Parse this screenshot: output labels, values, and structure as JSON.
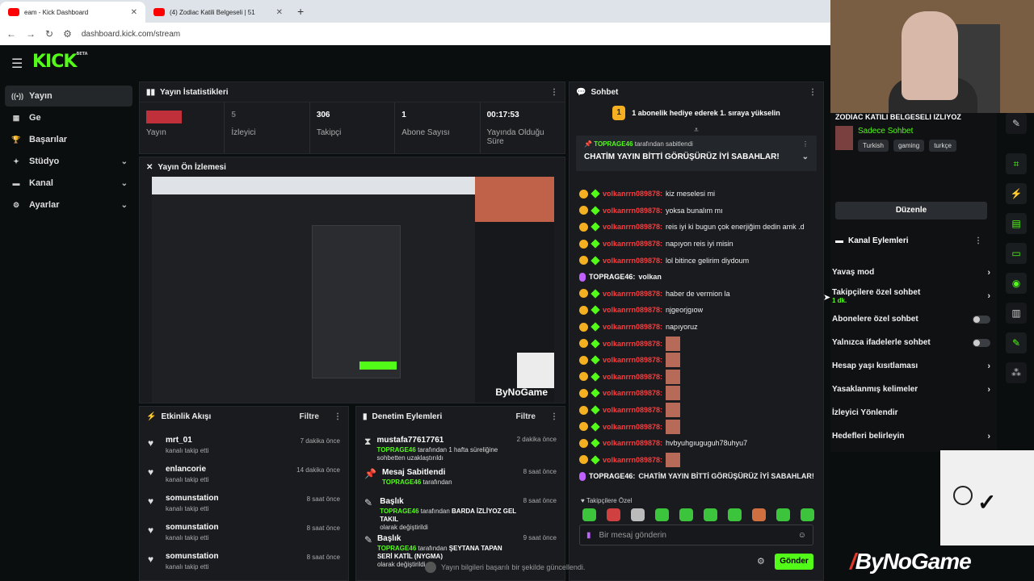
{
  "browser": {
    "tabs": [
      {
        "label": "eam - Kick Dashboard",
        "active": true
      },
      {
        "label": "(4) Zodiac Katili Belgeseli | 51",
        "active": false
      }
    ],
    "url": "dashboard.kick.com/stream"
  },
  "app": {
    "logo": "KICK",
    "beta": "BETA"
  },
  "sidebar": {
    "items": [
      {
        "label": "Yayın",
        "icon": "broadcast-icon"
      },
      {
        "label": "Ge",
        "icon": "dashboard-icon"
      },
      {
        "label": "Başarılar",
        "icon": "trophy-icon"
      },
      {
        "label": "Stüdyo",
        "icon": "studio-icon"
      },
      {
        "label": "Kanal",
        "icon": "channel-icon"
      },
      {
        "label": "Ayarlar",
        "icon": "settings-icon"
      }
    ]
  },
  "stats_panel": {
    "title": "Yayın İstatistikleri",
    "stats": [
      {
        "value": "",
        "label": "Yayın"
      },
      {
        "value": "5",
        "label": "İzleyici"
      },
      {
        "value": "306",
        "label": "Takipçi"
      },
      {
        "value": "1",
        "label": "Abone Sayısı"
      },
      {
        "value": "00:17:53",
        "label": "Yayında Olduğu Süre"
      }
    ]
  },
  "preview_panel": {
    "title": "Yayın Ön İzlemesi",
    "watermark": "ByNoGame"
  },
  "activity_panel": {
    "title": "Etkinlik Akışı",
    "filter": "Filtre",
    "items": [
      {
        "name": "mrt_01",
        "action": "kanalı takip etti",
        "time": "7 dakika önce"
      },
      {
        "name": "enlancorie",
        "action": "kanalı takip etti",
        "time": "14 dakika önce"
      },
      {
        "name": "somunstation",
        "action": "kanalı takip etti",
        "time": "8 saat önce"
      },
      {
        "name": "somunstation",
        "action": "kanalı takip etti",
        "time": "8 saat önce"
      },
      {
        "name": "somunstation",
        "action": "kanalı takip etti",
        "time": "8 saat önce"
      }
    ]
  },
  "moderation_panel": {
    "title": "Denetim Eylemleri",
    "filter": "Filtre",
    "items": [
      {
        "title": "mustafa77617761",
        "actor": "TOPRAGE46",
        "text": "tarafından 1 hafta süreliğine sohbetten uzaklaştırıldı",
        "time": "2 dakika önce",
        "icon": "hourglass-icon"
      },
      {
        "title": "Mesaj Sabitlendi",
        "actor": "TOPRAGE46",
        "text": "tarafından",
        "time": "8 saat önce",
        "icon": "pin-icon"
      },
      {
        "title": "Başlık",
        "actor": "TOPRAGE46",
        "text": "tarafından",
        "bold": "BARDA İZLİYOZ GEL TAKIL",
        "text2": "olarak değiştirildi",
        "time": "8 saat önce",
        "icon": "pencil-icon"
      },
      {
        "title": "Başlık",
        "actor": "TOPRAGE46",
        "text": "tarafından",
        "bold": "ŞEYTANA TAPAN SERİ KATİL (NYGMA)",
        "text2": "olarak değiştirildi",
        "time": "9 saat önce",
        "icon": "pencil-icon"
      }
    ]
  },
  "chat": {
    "title": "Sohbet",
    "banner": "1 abonelik hediye ederek 1. sıraya yükselin",
    "banner_coin": "1",
    "pinned": {
      "user": "TOPRAGE46",
      "by": "tarafından sabitlendi",
      "message": "CHATİM YAYIN BİTTİ GÖRÜŞÜRÜZ İYİ SABAHLAR!"
    },
    "messages": [
      {
        "user": "volkanrrn089878",
        "text": "kiz meselesi mi"
      },
      {
        "user": "volkanrrn089878",
        "text": "yoksa bunalım mı"
      },
      {
        "user": "volkanrrn089878",
        "text": "reis iyi ki bugun çok enerjiğim dedin amk .d"
      },
      {
        "user": "volkanrrn089878",
        "text": "napıyon reis iyi misin"
      },
      {
        "user": "volkanrrn089878",
        "text": "lol bitince gelirim diydoum"
      },
      {
        "user": "TOPRAGE46",
        "text": "volkan",
        "host": true
      },
      {
        "user": "volkanrrn089878",
        "text": "haber de vermion la"
      },
      {
        "user": "volkanrrn089878",
        "text": "njgeorjgıow"
      },
      {
        "user": "volkanrrn089878",
        "text": "napıyoruz"
      },
      {
        "user": "volkanrrn089878",
        "text": "",
        "emote": true
      },
      {
        "user": "volkanrrn089878",
        "text": "",
        "emote": true
      },
      {
        "user": "volkanrrn089878",
        "text": "",
        "emote": true
      },
      {
        "user": "volkanrrn089878",
        "text": "",
        "emote": true
      },
      {
        "user": "volkanrrn089878",
        "text": "",
        "emote": true
      },
      {
        "user": "volkanrrn089878",
        "text": "",
        "emote": true
      },
      {
        "user": "volkanrrn089878",
        "text": "hvbyuhgıuguguh78uhyu7"
      },
      {
        "user": "volkanrrn089878",
        "text": "",
        "emote": true
      },
      {
        "user": "TOPRAGE46",
        "text": "CHATİM YAYIN BİTTİ GÖRÜŞÜRÜZ İYİ SABAHLAR!",
        "host": true
      }
    ],
    "followers_only": "Takipçilere Özel",
    "input_placeholder": "Bir mesaj gönderin",
    "send_label": "Gönder"
  },
  "toast": "Yayın bilgileri başarılı bir şekilde güncellendi.",
  "right_panel": {
    "stream_title": "ZODIAC KATILI BELGESELI IZLIYOZ",
    "category": "Sadece Sohbet",
    "tags": [
      "Turkish",
      "gaming",
      "turkçe"
    ],
    "edit_label": "Düzenle",
    "channel_actions_title": "Kanal Eylemleri",
    "actions": [
      {
        "label": "Yavaş mod",
        "control": "arrow"
      },
      {
        "label": "Takipçilere özel sohbet",
        "sub": "1 dk.",
        "control": "arrow"
      },
      {
        "label": "Abonelere özel sohbet",
        "control": "toggle"
      },
      {
        "label": "Yalnızca ifadelerle sohbet",
        "control": "toggle"
      },
      {
        "label": "Hesap yaşı kısıtlaması",
        "control": "arrow"
      },
      {
        "label": "Yasaklanmış kelimeler",
        "control": "arrow"
      },
      {
        "label": "İzleyici Yönlendir",
        "control": "none"
      },
      {
        "label": "Hedefleri belirleyin",
        "control": "arrow"
      }
    ]
  },
  "overlay": {
    "brand": "ByNoGame"
  },
  "colors": {
    "accent": "#53fc18",
    "background": "#0b0e0f",
    "panel": "#191b1f",
    "user_red": "#ff3b3b"
  }
}
